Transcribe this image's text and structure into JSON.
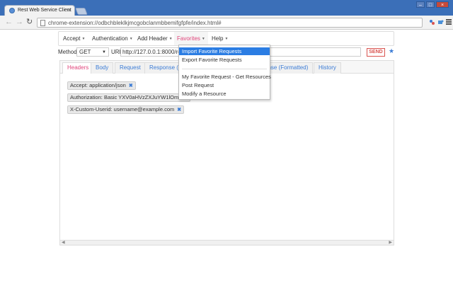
{
  "browser": {
    "tab_title": "Rest Web Service Client",
    "tab_close": "×",
    "url": "chrome-extension://odbchbleklkjmcgobclanmbbemifgfpfe/index.html#",
    "window_buttons": [
      "–",
      "□",
      "×"
    ],
    "nav": {
      "back": "←",
      "forward": "→",
      "reload": "↻"
    }
  },
  "nav": {
    "items": [
      {
        "label": "Accept"
      },
      {
        "label": "Authentication"
      },
      {
        "label": "Add Header"
      },
      {
        "label": "Favorites"
      },
      {
        "label": "Help"
      }
    ],
    "caret": "▼"
  },
  "request": {
    "method_label": "Method",
    "method_value": "GET",
    "url_label": "URL",
    "url_value": "http://127.0.0.1:8000/res",
    "send_label": "SEND",
    "star": "★"
  },
  "tabs": [
    {
      "label": "Headers"
    },
    {
      "label": "Body"
    },
    {
      "label": "Request"
    },
    {
      "label": "Response (S"
    },
    {
      "label": "onse (Formatted)"
    },
    {
      "label": "History"
    }
  ],
  "headers": [
    {
      "text": "Accept: application/json"
    },
    {
      "text": "Authorization: Basic YXV0aHVzZXJuYW1lOmF1c"
    },
    {
      "text": "X-Custom-Userid: username@example.com"
    }
  ],
  "remove_icon": "✖",
  "favorites_menu": {
    "items": [
      {
        "label": "Import Favorite Requests"
      },
      {
        "label": "Export Favorite Requests"
      },
      {
        "label": "My Favorite Request - Get Resources"
      },
      {
        "label": "Post Request"
      },
      {
        "label": "Modify a Resource"
      }
    ]
  },
  "colors": {
    "accent": "#e0457b",
    "link": "#3a7bd5",
    "selected": "#2b7de3",
    "send": "#d9534f"
  }
}
